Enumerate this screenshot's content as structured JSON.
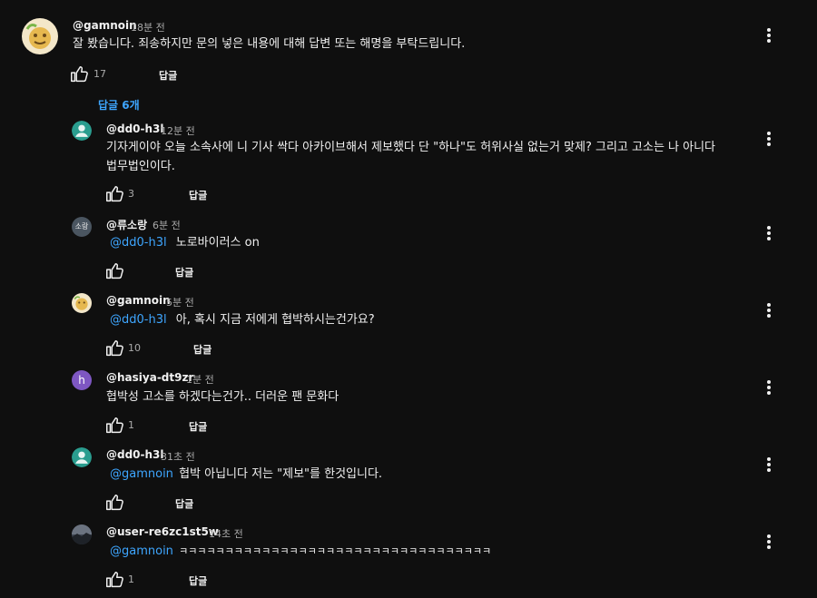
{
  "top_comment": {
    "author": "@gamnoin",
    "time": "18분 전",
    "text": "잘 봤습니다. 죄송하지만 문의 넣은 내용에 대해 답변 또는 해명을 부탁드립니다.",
    "likes": "17",
    "reply_label": "답글"
  },
  "replies_toggle": "답글 6개",
  "replies": [
    {
      "author": "@dd0-h3l",
      "time": "12분 전",
      "mention": "",
      "text_line1": "기자게이야 오늘 소속사에 니 기사 싹다 아카이브해서 제보했다 단 \"하나\"도 허위사실 없는거 맞제? 그리고 고소는 나 아니다",
      "text_line2": "법무법인이다.",
      "likes": "3",
      "reply_label": "답글"
    },
    {
      "author": "@류소랑",
      "time": "6분 전",
      "avatar_text": "소랑",
      "mention": "@dd0-h3l",
      "text": "노로바이러스 on",
      "likes": "",
      "reply_label": "답글"
    },
    {
      "author": "@gamnoin",
      "time": "5분 전",
      "mention": "@dd0-h3l",
      "text": "아, 혹시 지금 저에게 협박하시는건가요?",
      "likes": "10",
      "reply_label": "답글"
    },
    {
      "author": "@hasiya-dt9zr",
      "time": "1분 전",
      "avatar_text": "h",
      "mention": "",
      "text": "협박성 고소를 하겠다는건가.. 더러운 팬 문화다",
      "likes": "1",
      "reply_label": "답글"
    },
    {
      "author": "@dd0-h3l",
      "time": "31초 전",
      "mention": "@gamnoin",
      "text": "협박 아닙니다 저는 \"제보\"를 한것입니다.",
      "likes": "",
      "reply_label": "답글"
    },
    {
      "author": "@user-re6zc1st5w",
      "time": "14초 전",
      "mention": "@gamnoin",
      "text": "ㅋㅋㅋㅋㅋㅋㅋㅋㅋㅋㅋㅋㅋㅋㅋㅋㅋㅋㅋㅋㅋㅋㅋㅋㅋㅋㅋㅋㅋㅋㅋㅋㅋㅋ",
      "likes": "1",
      "reply_label": "답글"
    }
  ],
  "colors": {
    "background": "#0f0f0f",
    "mention": "#3ea6ff",
    "secondary_text": "#aaaaaa",
    "default_avatar_green": "#2a9d8f",
    "hasiya_avatar": "#7e57c2",
    "sorang_avatar": "#4a5560"
  }
}
